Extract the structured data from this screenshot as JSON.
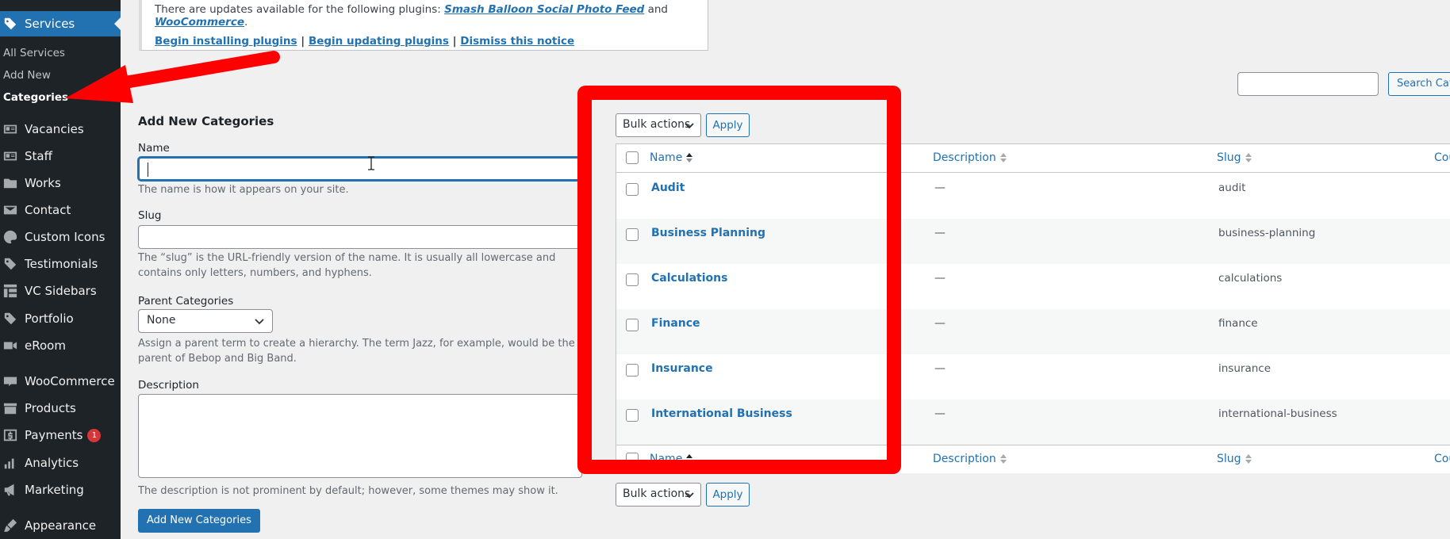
{
  "sidebar": {
    "items": [
      {
        "label": "Services",
        "icon": "tag-icon",
        "current": true
      },
      {
        "label": "Vacancies",
        "icon": "id-card-icon"
      },
      {
        "label": "Staff",
        "icon": "id-card-icon"
      },
      {
        "label": "Works",
        "icon": "folder-icon"
      },
      {
        "label": "Contact",
        "icon": "envelope-icon"
      },
      {
        "label": "Custom Icons",
        "icon": "palette-icon"
      },
      {
        "label": "Testimonials",
        "icon": "tag-icon"
      },
      {
        "label": "VC Sidebars",
        "icon": "grid-icon"
      },
      {
        "label": "Portfolio",
        "icon": "tag-icon"
      },
      {
        "label": "eRoom",
        "icon": "video-icon"
      },
      {
        "label": "WooCommerce",
        "icon": "woo-icon"
      },
      {
        "label": "Products",
        "icon": "archive-icon"
      },
      {
        "label": "Payments",
        "icon": "dollar-icon",
        "badge": "1"
      },
      {
        "label": "Analytics",
        "icon": "bar-chart-icon"
      },
      {
        "label": "Marketing",
        "icon": "megaphone-icon"
      },
      {
        "label": "Appearance",
        "icon": "brush-icon"
      }
    ],
    "submenu": [
      "All Services",
      "Add New",
      "Categories"
    ]
  },
  "notice": {
    "text_before": "There are updates available for the following plugins: ",
    "plugin1": "Smash Balloon Social Photo Feed",
    "and": " and ",
    "plugin2": "WooCommerce",
    "period": ".",
    "link_install": "Begin installing plugins",
    "sep": " | ",
    "link_update": "Begin updating plugins",
    "link_dismiss": "Dismiss this notice"
  },
  "form": {
    "title": "Add New Categories",
    "name_label": "Name",
    "name_value": "",
    "name_help": "The name is how it appears on your site.",
    "slug_label": "Slug",
    "slug_help": "The “slug” is the URL-friendly version of the name. It is usually all lowercase and contains only letters, numbers, and hyphens.",
    "parent_label": "Parent Categories",
    "parent_value": "None",
    "parent_help": "Assign a parent term to create a hierarchy. The term Jazz, for example, would be the parent of Bebop and Big Band.",
    "desc_label": "Description",
    "desc_help": "The description is not prominent by default; however, some themes may show it.",
    "submit": "Add New Categories"
  },
  "list": {
    "search_button": "Search Categories",
    "bulk_actions": "Bulk actions",
    "apply": "Apply",
    "columns": {
      "name": "Name",
      "description": "Description",
      "slug": "Slug",
      "count": "Count"
    },
    "rows": [
      {
        "name": "Audit",
        "description": "—",
        "slug": "audit"
      },
      {
        "name": "Business Planning",
        "description": "—",
        "slug": "business-planning"
      },
      {
        "name": "Calculations",
        "description": "—",
        "slug": "calculations"
      },
      {
        "name": "Finance",
        "description": "—",
        "slug": "finance"
      },
      {
        "name": "Insurance",
        "description": "—",
        "slug": "insurance"
      },
      {
        "name": "International Business",
        "description": "—",
        "slug": "international-business"
      }
    ]
  },
  "colors": {
    "accent": "#2271b1",
    "sidebar_bg": "#1d2327",
    "annotation": "#ff0000"
  }
}
